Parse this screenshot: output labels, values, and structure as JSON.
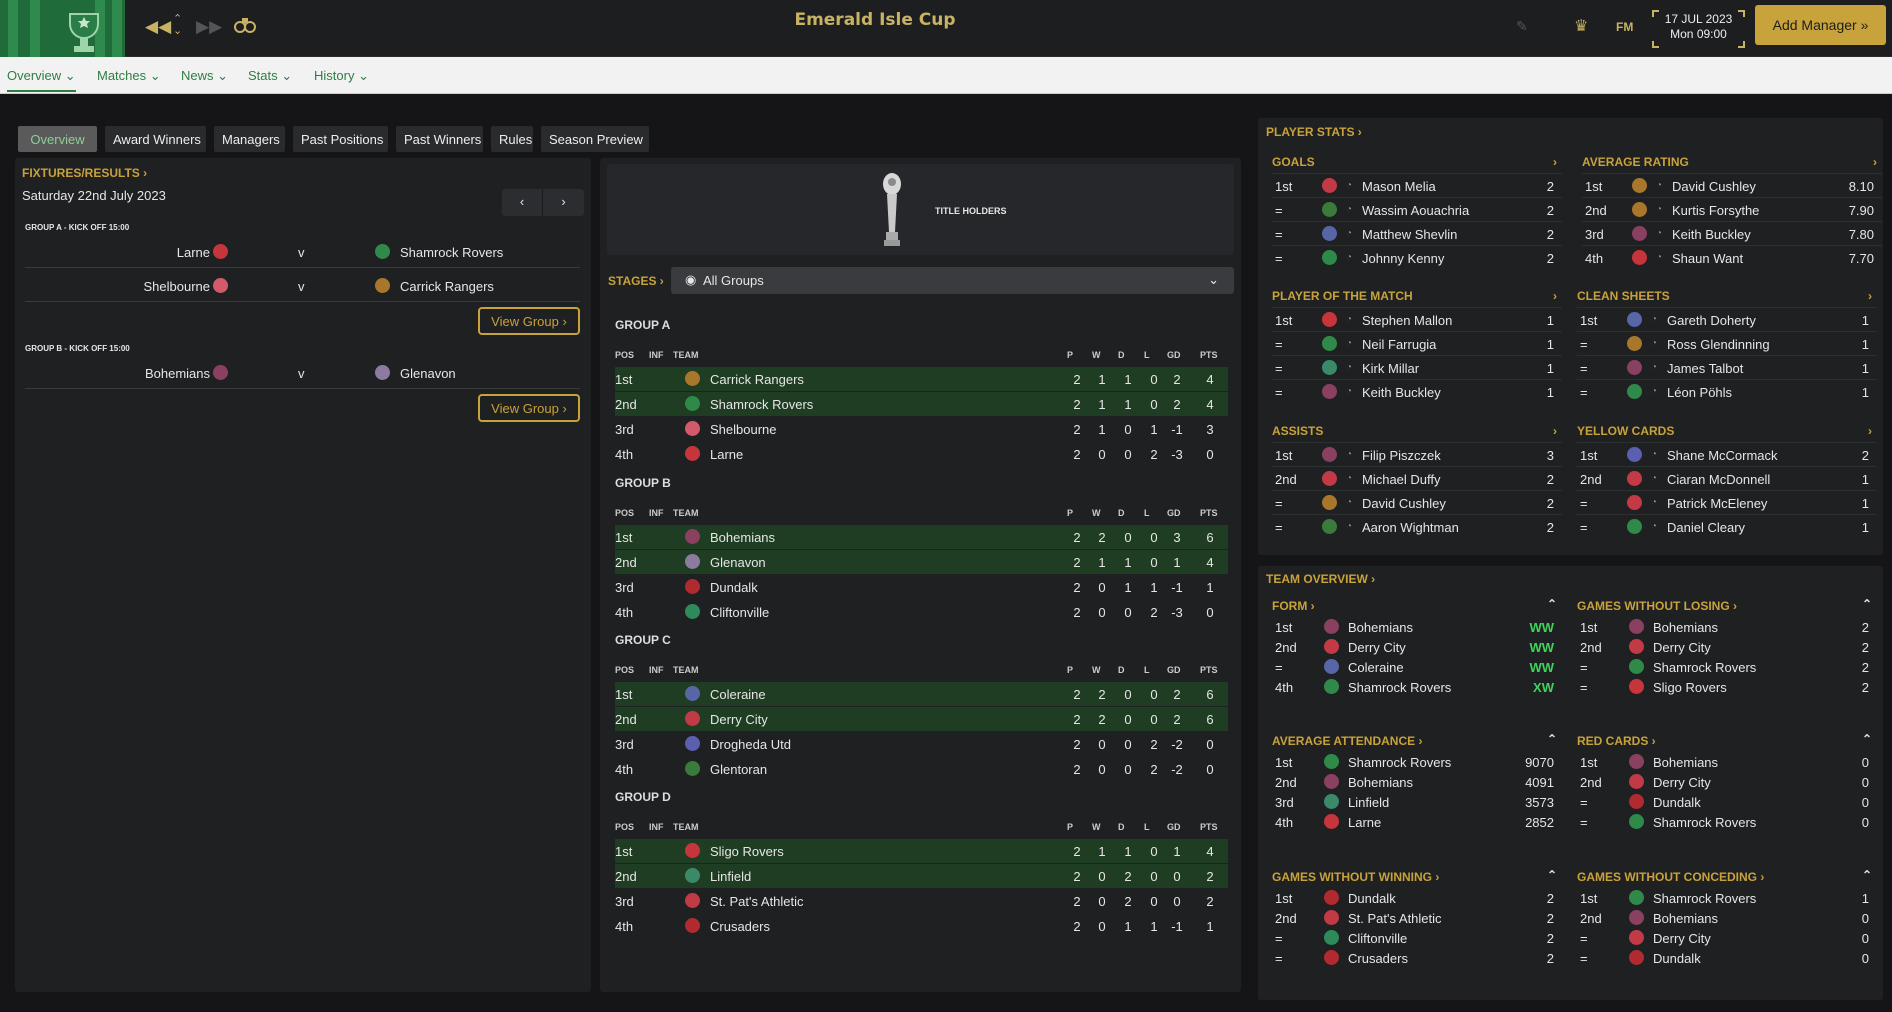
{
  "app": {
    "title": "Emerald Isle Cup",
    "date": "17 JUL 2023",
    "time": "Mon 09:00",
    "fm_label": "FM",
    "add_manager": "Add Manager"
  },
  "nav": [
    "Overview",
    "Matches",
    "News",
    "Stats",
    "History"
  ],
  "subtabs": [
    "Overview",
    "Award Winners",
    "Managers",
    "Past Positions",
    "Past Winners",
    "Rules",
    "Season Preview"
  ],
  "fixtures": {
    "header": "FIXTURES/RESULTS",
    "date": "Saturday 22nd July 2023",
    "vs": "v",
    "view_group": "View Group",
    "groups": [
      {
        "label": "GROUP A - KICK OFF 15:00",
        "matches": [
          {
            "home": "Larne",
            "away": "Shamrock Rovers",
            "hc": "#c7353c",
            "ac": "#2f8a4a"
          },
          {
            "home": "Shelbourne",
            "away": "Carrick Rangers",
            "hc": "#d25a6a",
            "ac": "#a8772b"
          }
        ]
      },
      {
        "label": "GROUP B - KICK OFF 15:00",
        "matches": [
          {
            "home": "Bohemians",
            "away": "Glenavon",
            "hc": "#8a4060",
            "ac": "#8d7aa0"
          }
        ]
      }
    ]
  },
  "center": {
    "title_holders": "TITLE HOLDERS",
    "stages_label": "STAGES",
    "stage_select": "All Groups",
    "columns": [
      "POS",
      "INF",
      "TEAM",
      "P",
      "W",
      "D",
      "L",
      "GD",
      "PTS"
    ],
    "groups": [
      {
        "name": "GROUP A",
        "rows": [
          [
            "1st",
            "Carrick Rangers",
            "2",
            "1",
            "1",
            "0",
            "2",
            "4",
            "#a8772b"
          ],
          [
            "2nd",
            "Shamrock Rovers",
            "2",
            "1",
            "1",
            "0",
            "2",
            "4",
            "#2f8a4a"
          ],
          [
            "3rd",
            "Shelbourne",
            "2",
            "1",
            "0",
            "1",
            "-1",
            "3",
            "#d25a6a"
          ],
          [
            "4th",
            "Larne",
            "2",
            "0",
            "0",
            "2",
            "-3",
            "0",
            "#c7353c"
          ]
        ]
      },
      {
        "name": "GROUP B",
        "rows": [
          [
            "1st",
            "Bohemians",
            "2",
            "2",
            "0",
            "0",
            "3",
            "6",
            "#8a4060"
          ],
          [
            "2nd",
            "Glenavon",
            "2",
            "1",
            "1",
            "0",
            "1",
            "4",
            "#8d7aa0"
          ],
          [
            "3rd",
            "Dundalk",
            "2",
            "0",
            "1",
            "1",
            "-1",
            "1",
            "#b02a30"
          ],
          [
            "4th",
            "Cliftonville",
            "2",
            "0",
            "0",
            "2",
            "-3",
            "0",
            "#2e8a5a"
          ]
        ]
      },
      {
        "name": "GROUP C",
        "rows": [
          [
            "1st",
            "Coleraine",
            "2",
            "2",
            "0",
            "0",
            "2",
            "6",
            "#5866a8"
          ],
          [
            "2nd",
            "Derry City",
            "2",
            "2",
            "0",
            "0",
            "2",
            "6",
            "#c23a45"
          ],
          [
            "3rd",
            "Drogheda Utd",
            "2",
            "0",
            "0",
            "2",
            "-2",
            "0",
            "#5a5fb0"
          ],
          [
            "4th",
            "Glentoran",
            "2",
            "0",
            "0",
            "2",
            "-2",
            "0",
            "#3a7a3a"
          ]
        ]
      },
      {
        "name": "GROUP D",
        "rows": [
          [
            "1st",
            "Sligo Rovers",
            "2",
            "1",
            "1",
            "0",
            "1",
            "4",
            "#c7353c"
          ],
          [
            "2nd",
            "Linfield",
            "2",
            "0",
            "2",
            "0",
            "0",
            "2",
            "#3a8a6a"
          ],
          [
            "3rd",
            "St. Pat's Athletic",
            "2",
            "0",
            "2",
            "0",
            "0",
            "2",
            "#c23a45"
          ],
          [
            "4th",
            "Crusaders",
            "2",
            "0",
            "1",
            "1",
            "-1",
            "1",
            "#b02a30"
          ]
        ]
      }
    ]
  },
  "player_stats": {
    "header": "PLAYER STATS",
    "sections": [
      {
        "title": "GOALS",
        "rows": [
          [
            "1st",
            "Mason Melia",
            "2",
            "#c23a45"
          ],
          [
            "=",
            "Wassim Aouachria",
            "2",
            "#3a7a3a"
          ],
          [
            "=",
            "Matthew Shevlin",
            "2",
            "#5866a8"
          ],
          [
            "=",
            "Johnny Kenny",
            "2",
            "#2f8a4a"
          ]
        ]
      },
      {
        "title": "AVERAGE RATING",
        "rows": [
          [
            "1st",
            "David Cushley",
            "8.10",
            "#a8772b"
          ],
          [
            "2nd",
            "Kurtis Forsythe",
            "7.90",
            "#a8772b"
          ],
          [
            "3rd",
            "Keith Buckley",
            "7.80",
            "#8a4060"
          ],
          [
            "4th",
            "Shaun Want",
            "7.70",
            "#c7353c"
          ]
        ]
      },
      {
        "title": "PLAYER OF THE MATCH",
        "rows": [
          [
            "1st",
            "Stephen Mallon",
            "1",
            "#c7353c"
          ],
          [
            "=",
            "Neil Farrugia",
            "1",
            "#2f8a4a"
          ],
          [
            "=",
            "Kirk Millar",
            "1",
            "#3a8a6a"
          ],
          [
            "=",
            "Keith Buckley",
            "1",
            "#8a4060"
          ]
        ]
      },
      {
        "title": "CLEAN SHEETS",
        "rows": [
          [
            "1st",
            "Gareth Doherty",
            "1",
            "#5866a8"
          ],
          [
            "=",
            "Ross Glendinning",
            "1",
            "#a8772b"
          ],
          [
            "=",
            "James Talbot",
            "1",
            "#8a4060"
          ],
          [
            "=",
            "Léon Pöhls",
            "1",
            "#2f8a4a"
          ]
        ]
      },
      {
        "title": "ASSISTS",
        "rows": [
          [
            "1st",
            "Filip Piszczek",
            "3",
            "#8a4060"
          ],
          [
            "2nd",
            "Michael Duffy",
            "2",
            "#c23a45"
          ],
          [
            "=",
            "David Cushley",
            "2",
            "#a8772b"
          ],
          [
            "=",
            "Aaron Wightman",
            "2",
            "#3a7a3a"
          ]
        ]
      },
      {
        "title": "YELLOW CARDS",
        "rows": [
          [
            "1st",
            "Shane McCormack",
            "2",
            "#5a5fb0"
          ],
          [
            "2nd",
            "Ciaran McDonnell",
            "1",
            "#c23a45"
          ],
          [
            "=",
            "Patrick McEleney",
            "1",
            "#c23a45"
          ],
          [
            "=",
            "Daniel Cleary",
            "1",
            "#2f8a4a"
          ]
        ]
      }
    ]
  },
  "team_overview": {
    "header": "TEAM OVERVIEW",
    "sections": [
      {
        "title": "FORM",
        "rows": [
          [
            "1st",
            "Bohemians",
            "WW",
            "#8a4060"
          ],
          [
            "2nd",
            "Derry City",
            "WW",
            "#c23a45"
          ],
          [
            "=",
            "Coleraine",
            "WW",
            "#5866a8"
          ],
          [
            "4th",
            "Shamrock Rovers",
            "XW",
            "#2f8a4a"
          ]
        ]
      },
      {
        "title": "GAMES WITHOUT LOSING",
        "rows": [
          [
            "1st",
            "Bohemians",
            "2",
            "#8a4060"
          ],
          [
            "2nd",
            "Derry City",
            "2",
            "#c23a45"
          ],
          [
            "=",
            "Shamrock Rovers",
            "2",
            "#2f8a4a"
          ],
          [
            "=",
            "Sligo Rovers",
            "2",
            "#c7353c"
          ]
        ]
      },
      {
        "title": "AVERAGE ATTENDANCE",
        "rows": [
          [
            "1st",
            "Shamrock Rovers",
            "9070",
            "#2f8a4a"
          ],
          [
            "2nd",
            "Bohemians",
            "4091",
            "#8a4060"
          ],
          [
            "3rd",
            "Linfield",
            "3573",
            "#3a8a6a"
          ],
          [
            "4th",
            "Larne",
            "2852",
            "#c7353c"
          ]
        ]
      },
      {
        "title": "RED CARDS",
        "rows": [
          [
            "1st",
            "Bohemians",
            "0",
            "#8a4060"
          ],
          [
            "2nd",
            "Derry City",
            "0",
            "#c23a45"
          ],
          [
            "=",
            "Dundalk",
            "0",
            "#b02a30"
          ],
          [
            "=",
            "Shamrock Rovers",
            "0",
            "#2f8a4a"
          ]
        ]
      },
      {
        "title": "GAMES WITHOUT WINNING",
        "rows": [
          [
            "1st",
            "Dundalk",
            "2",
            "#b02a30"
          ],
          [
            "2nd",
            "St. Pat's Athletic",
            "2",
            "#c23a45"
          ],
          [
            "=",
            "Cliftonville",
            "2",
            "#2e8a5a"
          ],
          [
            "=",
            "Crusaders",
            "2",
            "#b02a30"
          ]
        ]
      },
      {
        "title": "GAMES WITHOUT CONCEDING",
        "rows": [
          [
            "1st",
            "Shamrock Rovers",
            "1",
            "#2f8a4a"
          ],
          [
            "2nd",
            "Bohemians",
            "0",
            "#8a4060"
          ],
          [
            "=",
            "Derry City",
            "0",
            "#c23a45"
          ],
          [
            "=",
            "Dundalk",
            "0",
            "#b02a30"
          ]
        ]
      }
    ]
  },
  "colors": {
    "accent": "#c8a23a",
    "green_text": "#2f7d45",
    "qualify_row": "#1f3d22",
    "form_win": "#3fd35a"
  }
}
